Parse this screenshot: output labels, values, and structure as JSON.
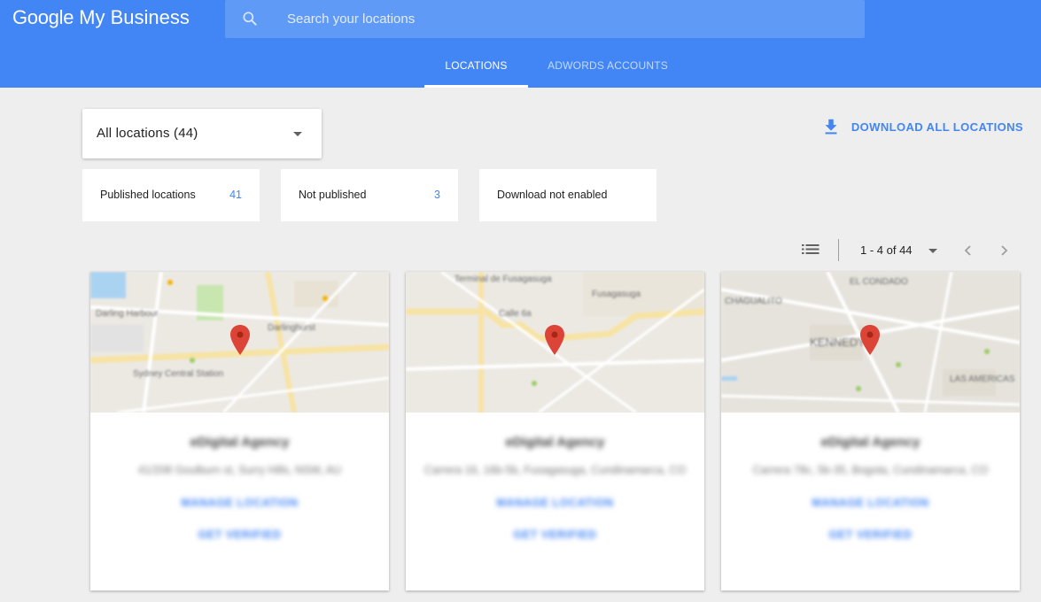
{
  "header": {
    "logo_google": "Google",
    "logo_product": "My Business",
    "search_placeholder": "Search your locations",
    "tabs": [
      {
        "label": "LOCATIONS",
        "active": true
      },
      {
        "label": "ADWORDS ACCOUNTS",
        "active": false
      }
    ]
  },
  "toolbar": {
    "selector_label": "All locations (44)",
    "download_label": "DOWNLOAD ALL LOCATIONS"
  },
  "stats": [
    {
      "label": "Published locations",
      "count": "41"
    },
    {
      "label": "Not published",
      "count": "3"
    },
    {
      "label": "Download not enabled",
      "count": ""
    }
  ],
  "pagination": {
    "range": "1 - 4 of 44"
  },
  "cards": [
    {
      "name": "eDigital Agency",
      "address": "41/208 Goulburn st, Surry Hills, NSW, AU",
      "manage_label": "MANAGE LOCATION",
      "verify_label": "GET VERIFIED",
      "map_labels": [
        "Darling Harbour",
        "Darlinghurst",
        "Sydney Central Station"
      ]
    },
    {
      "name": "eDigital Agency",
      "address": "Carrera 16, 16b-5b, Fusagasuga, Cundinamarca, CO",
      "manage_label": "MANAGE LOCATION",
      "verify_label": "GET VERIFIED",
      "map_labels": [
        "Terminal de Fusagasuga",
        "Fusagasuga",
        "Calle 6a"
      ]
    },
    {
      "name": "eDigital Agency",
      "address": "Carrera 78c, 5b-35, Bogota, Cundinamarca, CO",
      "manage_label": "MANAGE LOCATION",
      "verify_label": "GET VERIFIED",
      "map_labels": [
        "CHAGUALITO",
        "EL CONDADO",
        "KENNEDY",
        "LAS AMERICAS"
      ]
    }
  ],
  "colors": {
    "header_blue": "#4285f4",
    "link_blue": "#4285f4",
    "pin_red": "#db4437",
    "background": "#eeeeee"
  },
  "icons": {
    "search": "search-icon",
    "download": "download-icon",
    "list": "list-view-icon",
    "prev": "chevron-left-icon",
    "next": "chevron-right-icon",
    "pin": "map-pin-icon"
  }
}
